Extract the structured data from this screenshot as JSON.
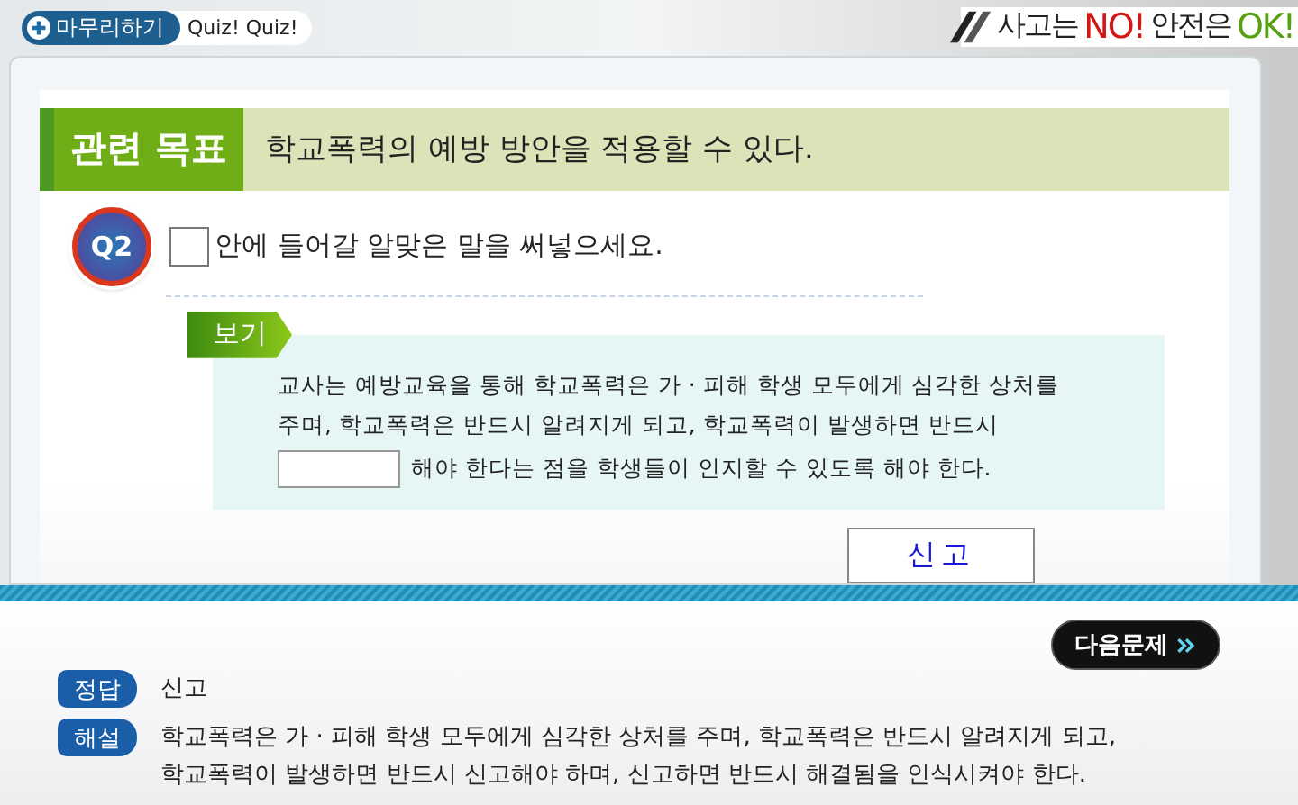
{
  "header": {
    "finish_button": "마무리하기",
    "quiz_label": "Quiz! Quiz!",
    "slogan": [
      {
        "text": "사고는",
        "kind": "plain"
      },
      {
        "text": "NO!",
        "kind": "no"
      },
      {
        "text": "안전은",
        "kind": "plain"
      },
      {
        "text": "OK!",
        "kind": "ok"
      }
    ]
  },
  "objective": {
    "label": "관련 목표",
    "text": "학교폭력의 예방 방안을 적용할 수 있다."
  },
  "question": {
    "number": "Q2",
    "text": "안에 들어갈 알맞은 말을 써넣으세요."
  },
  "example": {
    "label": "보기",
    "lines": [
      {
        "kind": "text",
        "text": "교사는 예방교육을 통해 학교폭력은 가 · 피해 학생 모두에게 심각한 상처를"
      },
      {
        "kind": "text",
        "text": "주며, 학교폭력은 반드시 알려지게 되고, 학교폭력이 발생하면 반드시"
      },
      {
        "kind": "blank",
        "text": "해야 한다는 점을 학생들이 인지할 수 있도록 해야 한다."
      }
    ]
  },
  "answer_field": {
    "value": "신고"
  },
  "next_button": "다음문제",
  "answer": {
    "label": "정답",
    "text": "신고"
  },
  "explanation": {
    "label": "해설",
    "lines": [
      "학교폭력은 가 · 피해 학생 모두에게 심각한 상처를 주며, 학교폭력은 반드시 알려지게 되고,",
      "학교폭력이 발생하면 반드시 신고해야 하며, 신고하면 반드시 해결됨을 인식시켜야 한다."
    ]
  }
}
